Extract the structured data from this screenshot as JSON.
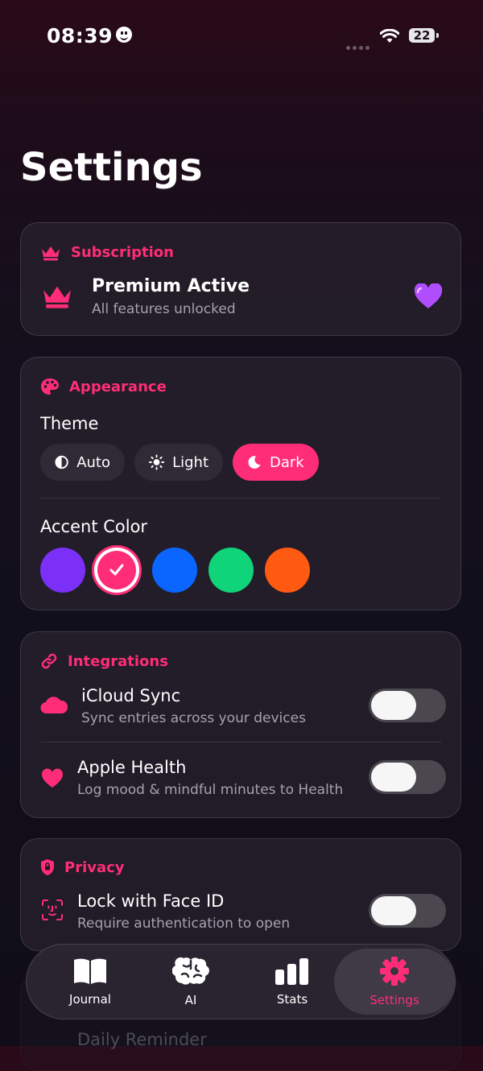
{
  "status_bar": {
    "time": "08:39",
    "battery": "22"
  },
  "page_title": "Settings",
  "subscription": {
    "header": "Subscription",
    "title": "Premium Active",
    "subtitle": "All features unlocked",
    "badge_icon": "purple-heart-emoji"
  },
  "appearance": {
    "header": "Appearance",
    "theme_label": "Theme",
    "theme_options": [
      {
        "label": "Auto",
        "icon": "half-circle-icon",
        "selected": false
      },
      {
        "label": "Light",
        "icon": "sun-icon",
        "selected": false
      },
      {
        "label": "Dark",
        "icon": "moon-icon",
        "selected": true
      }
    ],
    "accent_label": "Accent Color",
    "accent_colors": [
      "#7b2ff7",
      "#ff2d78",
      "#0a66ff",
      "#0fd47a",
      "#ff5a12"
    ],
    "accent_selected_index": 1
  },
  "integrations": {
    "header": "Integrations",
    "items": [
      {
        "title": "iCloud Sync",
        "subtitle": "Sync entries across your devices",
        "icon": "cloud-icon",
        "enabled": false
      },
      {
        "title": "Apple Health",
        "subtitle": "Log mood & mindful minutes to Health",
        "icon": "heart-icon",
        "enabled": false
      }
    ]
  },
  "privacy": {
    "header": "Privacy",
    "items": [
      {
        "title": "Lock with Face ID",
        "subtitle": "Require authentication to open",
        "icon": "face-id-icon",
        "enabled": false
      }
    ]
  },
  "partially_hidden": {
    "row_title": "Daily Reminder"
  },
  "tabbar": {
    "tabs": [
      {
        "label": "Journal",
        "icon": "book-icon",
        "active": false
      },
      {
        "label": "AI",
        "icon": "brain-icon",
        "active": false
      },
      {
        "label": "Stats",
        "icon": "bar-chart-icon",
        "active": false
      },
      {
        "label": "Settings",
        "icon": "gear-icon",
        "active": true
      }
    ]
  },
  "colors": {
    "accent": "#ff2d78",
    "toggle_off": "#4a474f"
  }
}
